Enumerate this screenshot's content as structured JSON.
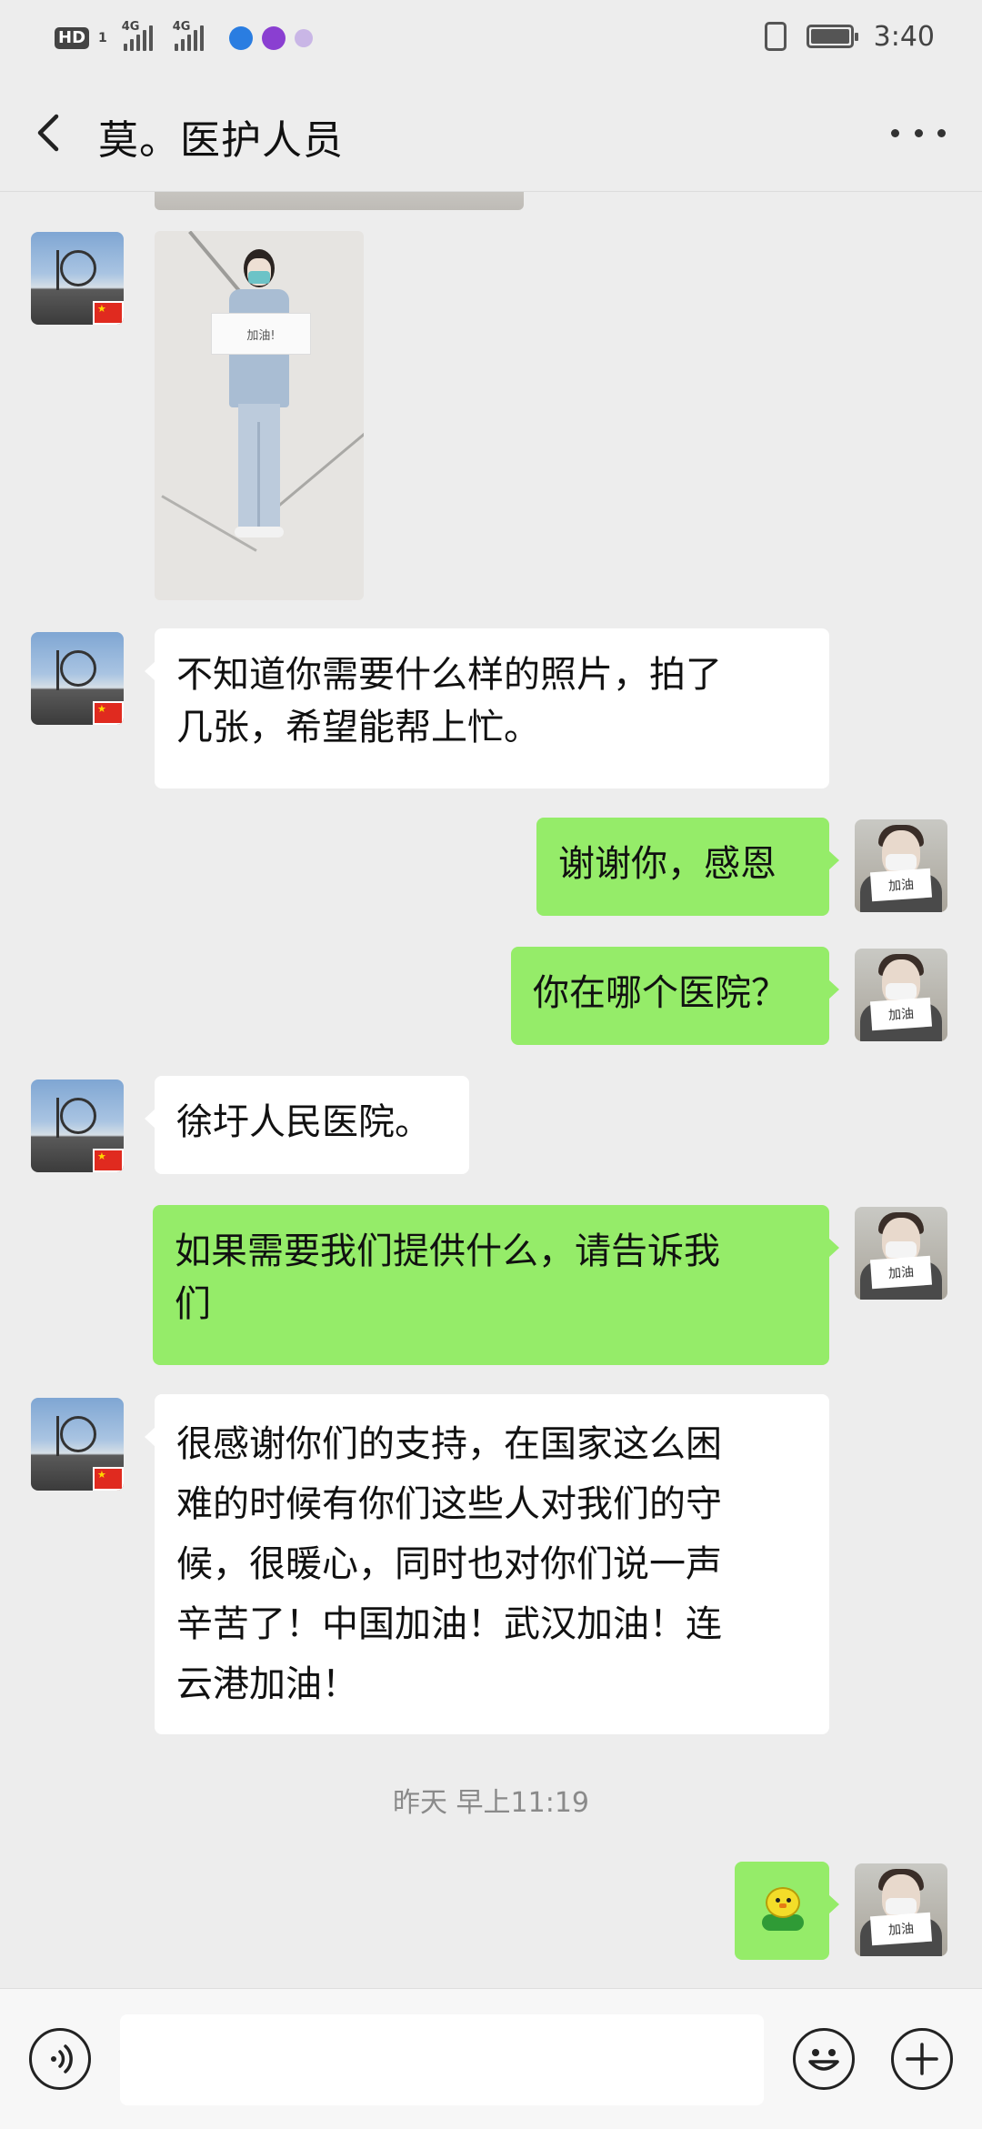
{
  "status_bar": {
    "hd_label": "HD",
    "sim_number": "1",
    "network_1": "4G",
    "network_2": "4G",
    "time": "3:40"
  },
  "header": {
    "title": "莫。医护人员",
    "back_icon": "chevron-left-icon",
    "more_icon": "more-dots-icon"
  },
  "messages": [
    {
      "sender": "contact",
      "type": "image"
    },
    {
      "sender": "contact",
      "type": "image"
    },
    {
      "sender": "contact",
      "type": "text",
      "lines": [
        "不知道你需要什么样的照片，拍了",
        "几张，希望能帮上忙。"
      ]
    },
    {
      "sender": "me",
      "type": "text",
      "lines": [
        "谢谢你，感恩"
      ]
    },
    {
      "sender": "me",
      "type": "text",
      "lines": [
        "你在哪个医院？"
      ]
    },
    {
      "sender": "contact",
      "type": "text",
      "lines": [
        "徐圩人民医院。"
      ]
    },
    {
      "sender": "me",
      "type": "text",
      "lines": [
        "如果需要我们提供什么，请告诉我",
        "们"
      ]
    },
    {
      "sender": "contact",
      "type": "text",
      "lines": [
        "很感谢你们的支持，在国家这么困",
        "难的时候有你们这些人对我们的守",
        "候，很暖心，同时也对你们说一声",
        "辛苦了！中国加油！武汉加油！连",
        "云港加油！"
      ]
    },
    {
      "sender": "me",
      "type": "sticker",
      "sticker": "chick-sticker"
    }
  ],
  "timestamp": "昨天 早上11:19",
  "input_bar": {
    "voice_icon": "voice-icon",
    "emoji_icon": "emoji-icon",
    "plus_icon": "plus-icon",
    "text_value": ""
  },
  "colors": {
    "background": "#ededed",
    "my_bubble": "#95ec69",
    "their_bubble": "#ffffff",
    "timestamp_text": "#8a8a8a"
  }
}
